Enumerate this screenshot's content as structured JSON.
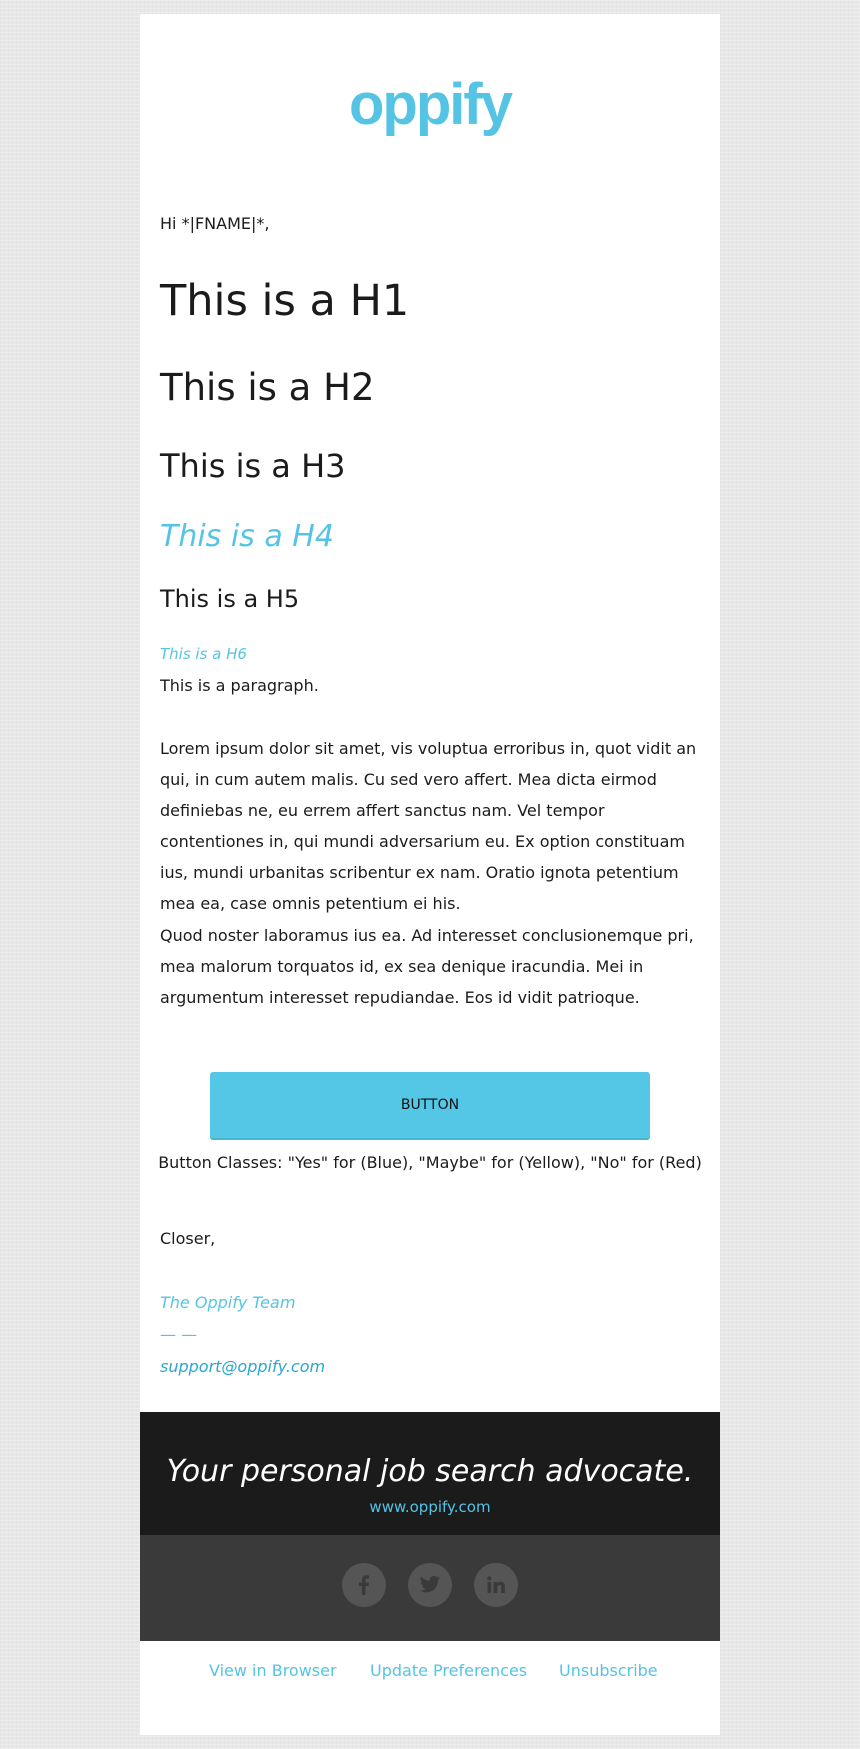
{
  "brand": {
    "logo_text": "oppify",
    "accent": "#55c4e4"
  },
  "email": {
    "greeting": "Hi *|FNAME|*,",
    "h1": "This is a H1",
    "h2": "This is a H2",
    "h3": "This is a H3",
    "h4": "This is a H4",
    "h5": "This is a H5",
    "h6": "This is a H6",
    "paragraph": "This is a paragraph.",
    "lorem1": "Lorem ipsum dolor sit amet, vis voluptua erroribus in, quot vidit an qui, in cum autem malis. Cu sed vero affert. Mea dicta eirmod definiebas ne, eu errem affert sanctus nam. Vel tempor contentiones in, qui mundi adversarium eu. Ex option constituam ius, mundi urbanitas scribentur ex nam. Oratio ignota petentium mea ea, case omnis petentium ei his.",
    "lorem2": "Quod noster laboramus ius ea. Ad interesset conclusionemque pri, mea malorum torquatos id, ex sea denique iracundia. Mei in argumentum interesset repudiandae. Eos id vidit patrioque.",
    "button_label": "BUTTON",
    "button_note": "Button Classes: \"Yes\" for (Blue), \"Maybe\" for (Yellow), \"No\" for (Red)",
    "closer": "Closer,",
    "team": "The Oppify Team",
    "dash": "— —",
    "support_email": "support@oppify.com"
  },
  "footer": {
    "tagline": "Your personal job search advocate.",
    "website": "www.oppify.com",
    "social": [
      {
        "icon": "facebook-icon"
      },
      {
        "icon": "twitter-icon"
      },
      {
        "icon": "linkedin-icon"
      }
    ],
    "links": {
      "view_in_browser": "View in Browser",
      "update_preferences": "Update Preferences",
      "unsubscribe": "Unsubscribe"
    }
  }
}
